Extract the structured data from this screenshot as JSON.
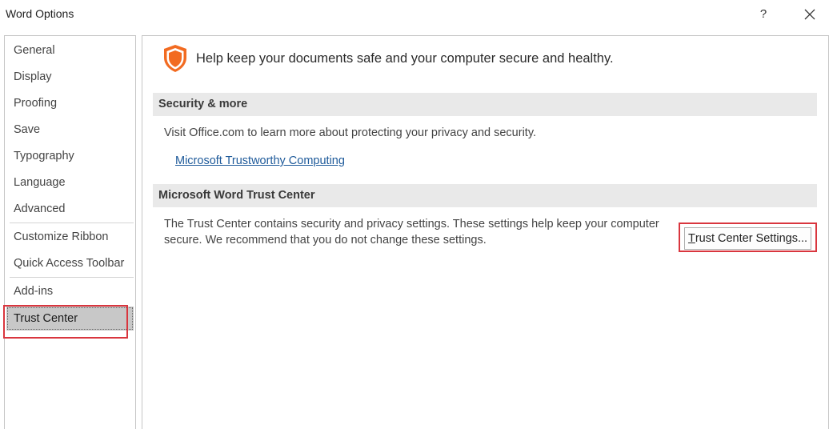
{
  "window": {
    "title": "Word Options",
    "help_label": "?",
    "close_icon": "close-icon"
  },
  "sidebar": {
    "items": [
      {
        "label": "General"
      },
      {
        "label": "Display"
      },
      {
        "label": "Proofing"
      },
      {
        "label": "Save"
      },
      {
        "label": "Typography"
      },
      {
        "label": "Language"
      },
      {
        "label": "Advanced"
      },
      {
        "label": "Customize Ribbon"
      },
      {
        "label": "Quick Access Toolbar"
      },
      {
        "label": "Add-ins"
      },
      {
        "label": "Trust Center"
      }
    ],
    "selected": "Trust Center"
  },
  "main": {
    "header_icon": "shield-icon",
    "header_text": "Help keep your documents safe and your computer secure and healthy.",
    "security_section": {
      "title": "Security & more",
      "description": "Visit Office.com to learn more about protecting your privacy and security.",
      "link": "Microsoft Trustworthy Computing"
    },
    "trust_center_section": {
      "title": "Microsoft Word Trust Center",
      "description_line1": "The Trust Center contains security and privacy settings. These settings help keep your computer",
      "description_line2": "secure. We recommend that you do not change these settings.",
      "button_label": "Trust Center Settings...",
      "button_mnemonic": "T",
      "button_rest": "rust Center Settings..."
    }
  },
  "colors": {
    "highlight": "#d9363e",
    "shield": "#f26b21",
    "link": "#1e5a9a",
    "selected_bg": "#c8c8c8",
    "section_bg": "#e9e9e9"
  }
}
